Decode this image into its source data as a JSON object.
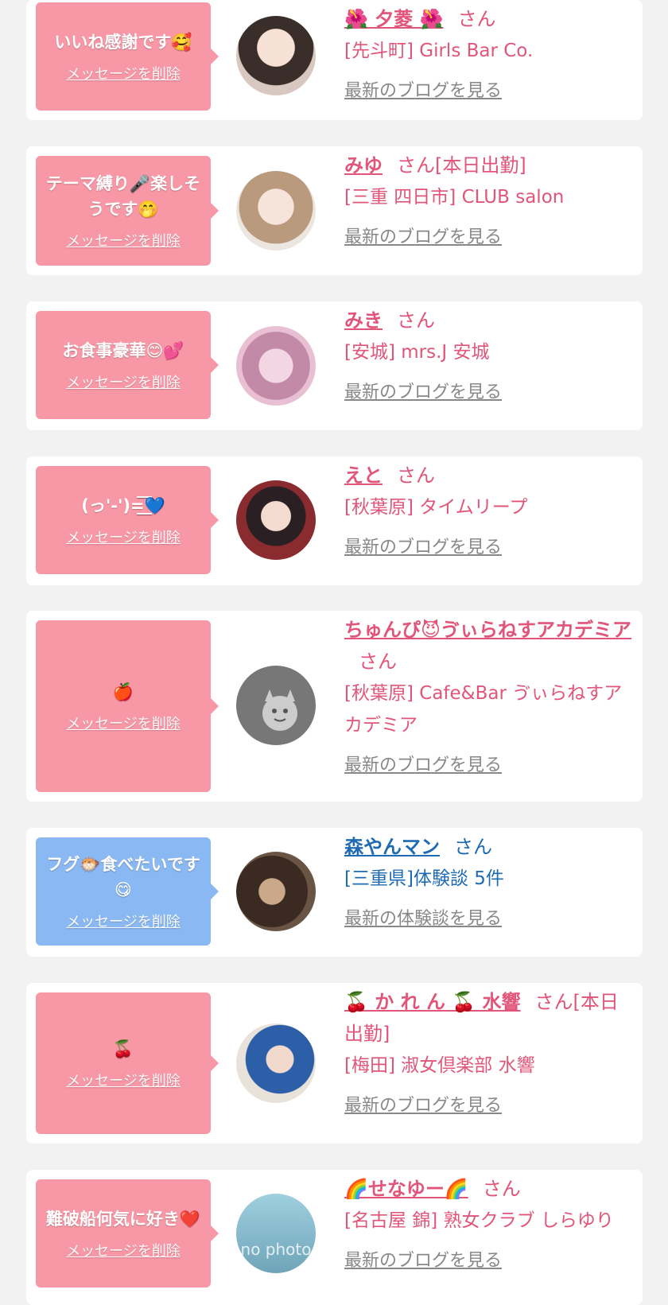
{
  "delete_label": "メッセージを削除",
  "cards": [
    {
      "message": "いいね感謝です🥰",
      "name": "🌺 夕菱 🌺",
      "suffix": "さん",
      "shop": "[先斗町] Girls Bar Co.",
      "link": "最新のブログを見る",
      "color": "pink"
    },
    {
      "message": "テーマ縛り🎤楽しそうです🤭",
      "name": "みゆ",
      "suffix": "さん[本日出勤]",
      "shop": "[三重 四日市] CLUB salon",
      "link": "最新のブログを見る",
      "color": "pink"
    },
    {
      "message": "お食事豪華😊💕",
      "name": "みき",
      "suffix": "さん",
      "shop": "[安城] mrs.J 安城",
      "link": "最新のブログを見る",
      "color": "pink"
    },
    {
      "message": "(っ'-')=͟͟͞͞💙",
      "name": "えと",
      "suffix": "さん",
      "shop": "[秋葉原] タイムリープ",
      "link": "最新のブログを見る",
      "color": "pink"
    },
    {
      "message": "🍎",
      "name": "ちゅんぴ😈ゔぃらねすアカデミア",
      "suffix": "さん",
      "shop": "[秋葉原] Cafe&Bar ゔぃらねすアカデミア",
      "link": "最新のブログを見る",
      "color": "pink"
    },
    {
      "message": "フグ🐡食べたいです😋",
      "name": "森やんマン",
      "suffix": "さん",
      "shop": "[三重県]体験談 5件",
      "link": "最新の体験談を見る",
      "color": "blue"
    },
    {
      "message": "🍒",
      "name": "🍒 か れ ん 🍒 水響",
      "suffix": "さん[本日出勤]",
      "shop": "[梅田] 淑女倶楽部 水響",
      "link": "最新のブログを見る",
      "color": "pink"
    },
    {
      "message": "難破船何気に好き❤️",
      "name": "🌈せなゆー🌈",
      "suffix": "さん",
      "shop": "[名古屋 錦] 熟女クラブ しらゆり",
      "link": "最新のブログを見る",
      "color": "pink"
    }
  ],
  "no_photo_text": "no photo"
}
